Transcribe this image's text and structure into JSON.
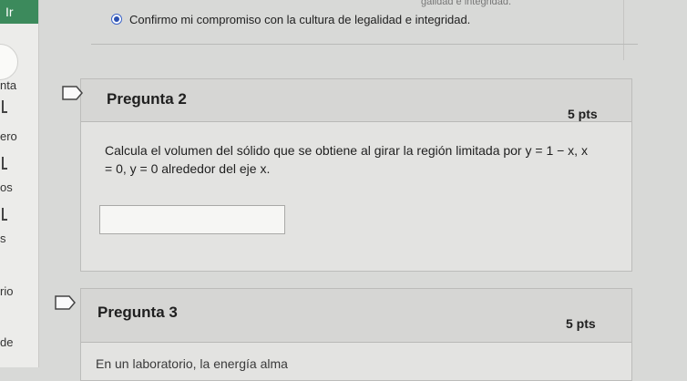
{
  "sidebar": {
    "items": [
      {
        "label": "nta"
      },
      {
        "label": "ero"
      },
      {
        "label": "os"
      },
      {
        "label": "s"
      },
      {
        "label": "rio"
      },
      {
        "label": "de"
      }
    ]
  },
  "prev_question": {
    "option_truncated": "galidad e integridad.",
    "selected_option": "Confirmo mi compromiso con la cultura de legalidad e integridad."
  },
  "questions": [
    {
      "title": "Pregunta 2",
      "points": "5 pts",
      "text_line1": "Calcula el volumen del sólido que se obtiene al girar la región limitada por y = 1 − x, x",
      "text_line2": "= 0, y = 0 alrededor del eje x.",
      "answer_value": ""
    },
    {
      "title": "Pregunta 3",
      "points": "5 pts",
      "text_line1": "En un laboratorio, la energía alma"
    }
  ]
}
